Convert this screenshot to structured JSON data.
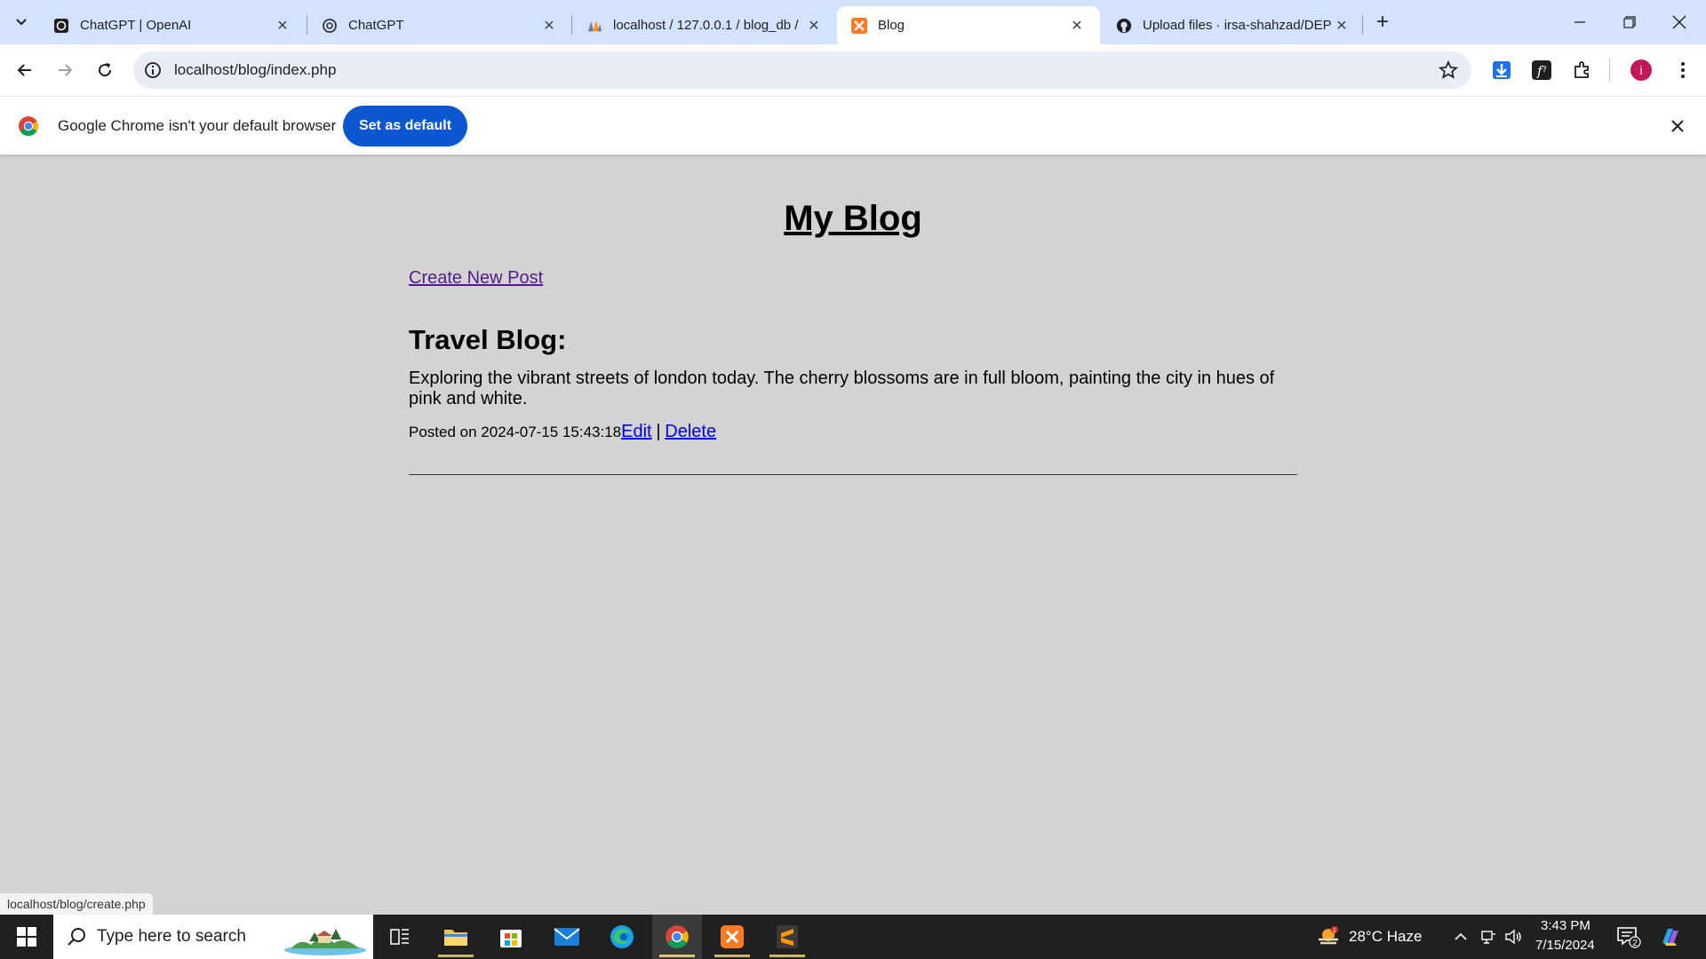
{
  "browser": {
    "tabs": [
      {
        "title": "ChatGPT | OpenAI",
        "favicon": "openai-icon"
      },
      {
        "title": "ChatGPT",
        "favicon": "openai-icon"
      },
      {
        "title": "localhost / 127.0.0.1 / blog_db /",
        "favicon": "phpmyadmin-icon"
      },
      {
        "title": "Blog",
        "favicon": "xampp-icon",
        "active": true
      },
      {
        "title": "Upload files · irsa-shahzad/DEP",
        "favicon": "github-icon"
      }
    ],
    "url": "localhost/blog/index.php",
    "profile_initial": "i",
    "infobar": {
      "message": "Google Chrome isn't your default browser",
      "button": "Set as default"
    },
    "status_url": "localhost/blog/create.php"
  },
  "blog": {
    "title": "My Blog",
    "create_link": "Create New Post",
    "posts": [
      {
        "title": "Travel Blog:",
        "body": "Exploring the vibrant streets of london today. The cherry blossoms are in full bloom, painting the city in hues of pink and white.",
        "meta": "Posted on 2024-07-15 15:43:18",
        "edit": "Edit",
        "separator": "|",
        "delete": "Delete"
      }
    ]
  },
  "taskbar": {
    "search_placeholder": "Type here to search",
    "weather": "28°C  Haze",
    "weather_badge": "1",
    "time": "3:43 PM",
    "date": "7/15/2024",
    "notification_count": "2"
  },
  "colors": {
    "tabstrip": "#d3e3fd",
    "page_background": "#d3d3d3",
    "button_blue": "#0b57d0",
    "visited_link": "#551a8b",
    "link": "#0000ee",
    "profile": "#c2185b"
  }
}
